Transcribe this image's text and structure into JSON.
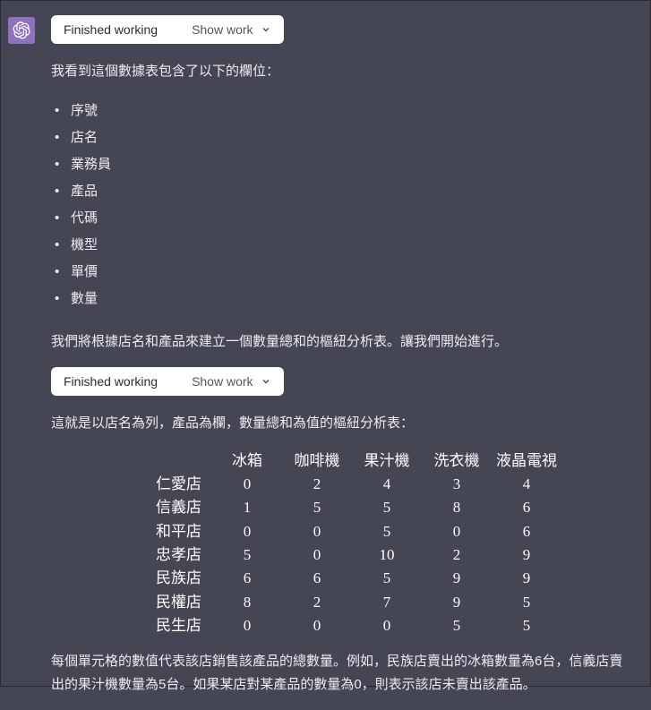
{
  "avatar": {
    "name": "openai-logo"
  },
  "pill": {
    "status": "Finished working",
    "toggle_label": "Show work"
  },
  "messages": {
    "intro": "我看到這個數據表包含了以下的欄位：",
    "fields": [
      "序號",
      "店名",
      "業務員",
      "產品",
      "代碼",
      "機型",
      "單價",
      "數量"
    ],
    "plan": "我們將根據店名和產品來建立一個數量總和的樞紐分析表。讓我們開始進行。",
    "result_intro": "這就是以店名為列，產品為欄，數量總和為值的樞紐分析表：",
    "explanation": "每個單元格的數值代表該店銷售該產品的總數量。例如，民族店賣出的冰箱數量為6台，信義店賣出的果汁機數量為5台。如果某店對某產品的數量為0，則表示該店未賣出該產品。"
  },
  "chart_data": {
    "type": "table",
    "columns": [
      "冰箱",
      "咖啡機",
      "果汁機",
      "洗衣機",
      "液晶電視"
    ],
    "rows": [
      "仁愛店",
      "信義店",
      "和平店",
      "忠孝店",
      "民族店",
      "民權店",
      "民生店"
    ],
    "values": [
      [
        0,
        2,
        4,
        3,
        4
      ],
      [
        1,
        5,
        5,
        8,
        6
      ],
      [
        0,
        0,
        5,
        0,
        6
      ],
      [
        5,
        0,
        10,
        2,
        9
      ],
      [
        6,
        6,
        5,
        9,
        9
      ],
      [
        8,
        2,
        7,
        9,
        5
      ],
      [
        0,
        0,
        0,
        5,
        5
      ]
    ]
  }
}
